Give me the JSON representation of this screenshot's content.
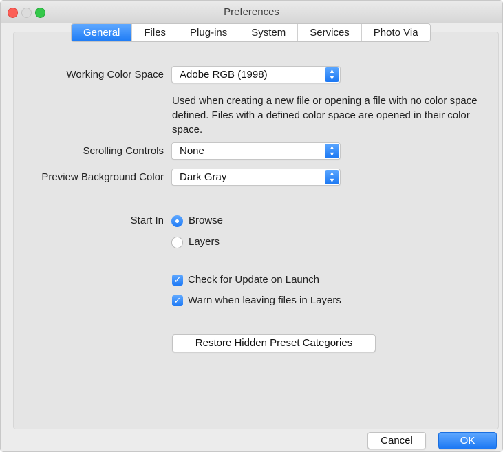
{
  "window": {
    "title": "Preferences"
  },
  "tabs": [
    {
      "label": "General",
      "active": true
    },
    {
      "label": "Files",
      "active": false
    },
    {
      "label": "Plug-ins",
      "active": false
    },
    {
      "label": "System",
      "active": false
    },
    {
      "label": "Services",
      "active": false
    },
    {
      "label": "Photo Via",
      "active": false
    }
  ],
  "general": {
    "working_color_space": {
      "label": "Working Color Space",
      "value": "Adobe RGB (1998)",
      "note": "Used when creating a new file or opening a file with no color space defined. Files with a defined color space are opened in their color space."
    },
    "scrolling_controls": {
      "label": "Scrolling Controls",
      "value": "None"
    },
    "preview_background": {
      "label": "Preview Background Color",
      "value": "Dark Gray"
    },
    "start_in": {
      "label": "Start In",
      "options": [
        {
          "label": "Browse",
          "selected": true
        },
        {
          "label": "Layers",
          "selected": false
        }
      ]
    },
    "checkboxes": [
      {
        "label": "Check for Update on Launch",
        "checked": true
      },
      {
        "label": "Warn when leaving files in Layers",
        "checked": true
      }
    ],
    "restore_button": "Restore Hidden Preset Categories"
  },
  "footer": {
    "cancel": "Cancel",
    "ok": "OK"
  },
  "colors": {
    "accent": "#1d7bf5",
    "close": "#fc5f57",
    "maximize": "#34c84a"
  }
}
